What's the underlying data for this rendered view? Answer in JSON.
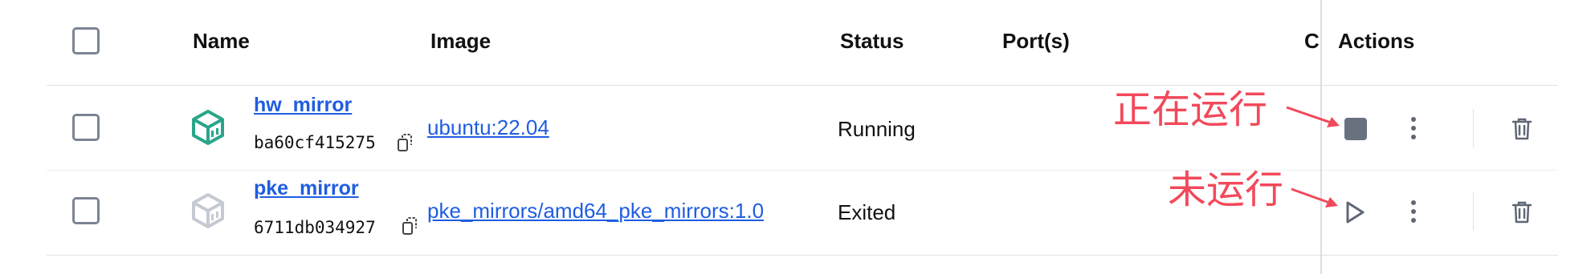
{
  "header": {
    "name": "Name",
    "image": "Image",
    "status": "Status",
    "ports": "Port(s)",
    "cpu_truncated": "C",
    "actions": "Actions"
  },
  "rows": [
    {
      "name": "hw_mirror",
      "container_id": "ba60cf415275",
      "image": "ubuntu:22.04",
      "status": "Running",
      "icon": "container-running-icon",
      "action": "stop-icon",
      "annotation": "正在运行"
    },
    {
      "name": "pke_mirror",
      "container_id": "6711db034927",
      "image": "pke_mirrors/amd64_pke_mirrors:1.0",
      "status": "Exited",
      "icon": "container-exited-icon",
      "action": "play-icon",
      "annotation": "未运行"
    }
  ],
  "colors": {
    "link": "#1f5de0",
    "running_icon": "#2aa58b",
    "exited_icon": "#c5cad2",
    "annotation": "#f2495b",
    "button": "#687180"
  }
}
